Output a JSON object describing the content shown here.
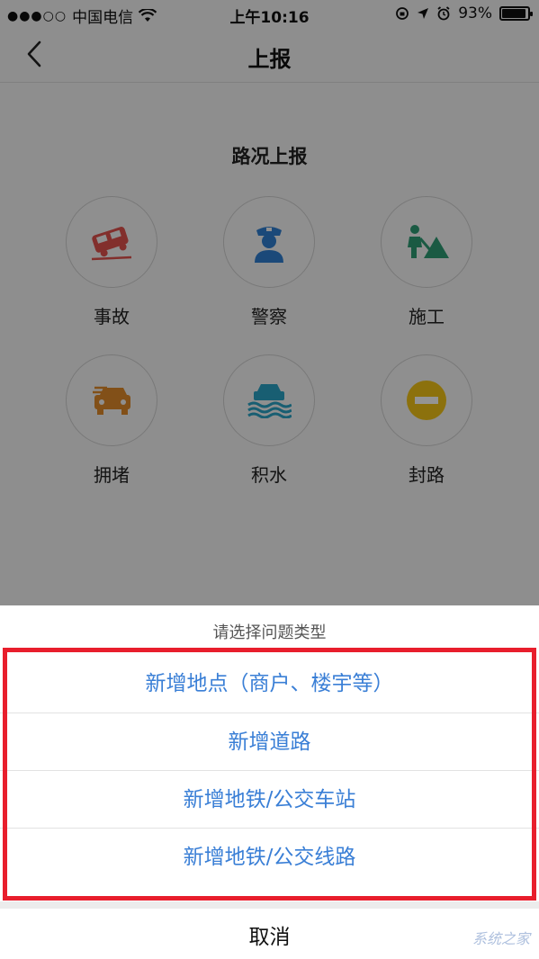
{
  "status_bar": {
    "signal": "●●●○○",
    "carrier": "中国电信",
    "time": "上午10:16",
    "battery": "93%",
    "battery_level": 0.93
  },
  "nav": {
    "title": "上报"
  },
  "section_title": "路况上报",
  "report_types": [
    {
      "label": "事故",
      "icon": "car-accident-icon",
      "color": "#e0514c"
    },
    {
      "label": "警察",
      "icon": "police-icon",
      "color": "#2f7fd1"
    },
    {
      "label": "施工",
      "icon": "construction-icon",
      "color": "#2e9c74"
    },
    {
      "label": "拥堵",
      "icon": "traffic-jam-icon",
      "color": "#e08a2a"
    },
    {
      "label": "积水",
      "icon": "flood-icon",
      "color": "#2aa3c4"
    },
    {
      "label": "封路",
      "icon": "road-closed-icon",
      "color": "#f2c318"
    }
  ],
  "sheet": {
    "title": "请选择问题类型",
    "options": [
      "新增地点（商户、楼宇等）",
      "新增道路",
      "新增地铁/公交车站",
      "新增地铁/公交线路"
    ],
    "cancel": "取消"
  },
  "watermark": "系统之家"
}
